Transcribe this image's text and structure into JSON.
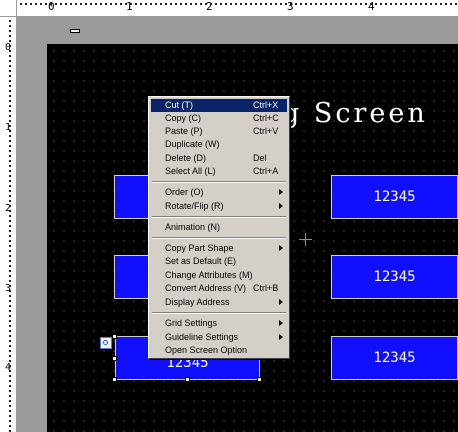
{
  "ruler": {
    "top_labels": [
      "0",
      "1",
      "2",
      "3",
      "4"
    ],
    "left_labels": [
      "0",
      "1",
      "2",
      "3",
      "4"
    ]
  },
  "screen": {
    "title": "g Screen",
    "parts": [
      {
        "value": ""
      },
      {
        "value": "12345"
      },
      {
        "value": ""
      },
      {
        "value": "12345"
      },
      {
        "value": "12345"
      },
      {
        "value": "12345"
      }
    ]
  },
  "context_menu": {
    "items": [
      {
        "label": "Cut (T)",
        "shortcut": "Ctrl+X",
        "highlighted": true
      },
      {
        "label": "Copy (C)",
        "shortcut": "Ctrl+C"
      },
      {
        "label": "Paste (P)",
        "shortcut": "Ctrl+V"
      },
      {
        "label": "Duplicate (W)",
        "shortcut": ""
      },
      {
        "label": "Delete (D)",
        "shortcut": "Del"
      },
      {
        "label": "Select All (L)",
        "shortcut": "Ctrl+A"
      },
      {
        "label": "Order (O)",
        "submenu": true
      },
      {
        "label": "Rotate/Flip (R)",
        "submenu": true
      },
      {
        "label": "Animation (N)"
      },
      {
        "label": "Copy Part Shape",
        "submenu": true
      },
      {
        "label": "Set as Default (E)"
      },
      {
        "label": "Change Attributes (M)"
      },
      {
        "label": "Convert Address (V)",
        "shortcut": "Ctrl+B"
      },
      {
        "label": "Display Address",
        "submenu": true
      },
      {
        "label": "Grid Settings",
        "submenu": true
      },
      {
        "label": "Guideline Settings",
        "submenu": true
      },
      {
        "label": "Open Screen Option"
      }
    ]
  },
  "colors": {
    "screen_background": "#000000",
    "part_fill": "#1010ff",
    "menu_background": "#d4d0c8",
    "menu_highlight": "#0a246a"
  }
}
